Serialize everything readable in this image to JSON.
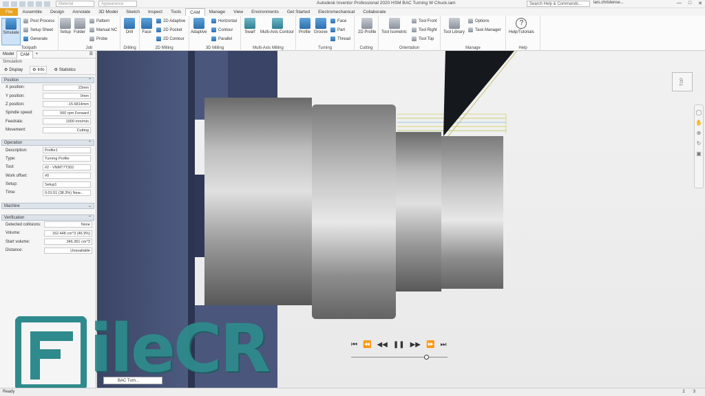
{
  "titlebar": {
    "material_placeholder": "Material",
    "appearance_placeholder": "Appearance",
    "doc_title": "Autodesk Inventor Professional 2020   HSM BAC Turning W Chuck.iam",
    "search_label": "Search Help & Commands...",
    "user": "lars.christense..."
  },
  "menu": {
    "tabs": [
      "File",
      "Assemble",
      "Design",
      "Annotate",
      "3D Model",
      "Sketch",
      "Inspect",
      "Tools",
      "CAM",
      "Manage",
      "View",
      "Environments",
      "Get Started",
      "Electromechanical",
      "Collaborate"
    ],
    "active": "CAM"
  },
  "ribbon": {
    "toolpath": {
      "label": "Toolpath",
      "simulate": "Simulate",
      "post_process": "Post Process",
      "setup_sheet": "Setup Sheet",
      "generate": "Generate"
    },
    "job": {
      "label": "Job",
      "setup": "Setup",
      "folder": "Folder",
      "pattern": "Pattern",
      "manual_nc": "Manual NC",
      "probe": "Probe"
    },
    "drilling": {
      "label": "Drilling",
      "drill": "Drill"
    },
    "milling2d": {
      "label": "2D Milling",
      "face": "Face",
      "adaptive": "2D Adaptive",
      "pocket": "2D Pocket",
      "contour": "2D Contour"
    },
    "milling3d": {
      "label": "3D Milling",
      "adaptive": "Adaptive",
      "horizontal": "Horizontal",
      "contour": "Contour",
      "parallel": "Parallel"
    },
    "multiaxis": {
      "label": "Multi-Axis Milling",
      "swarf": "Swarf",
      "multi_axis_contour": "Multi-Axis Contour"
    },
    "turning": {
      "label": "Turning",
      "profile": "Profile",
      "groove": "Groove",
      "face": "Face",
      "part": "Part",
      "thread": "Thread"
    },
    "cutting": {
      "label": "Cutting",
      "profile2d": "2D Profile"
    },
    "orientation": {
      "label": "Orientation",
      "tool_isometric": "Tool Isometric",
      "tool_front": "Tool Front",
      "tool_right": "Tool Right",
      "tool_top": "Tool Top"
    },
    "manage": {
      "label": "Manage",
      "tool_library": "Tool Library",
      "options": "Options",
      "task_manager": "Task Manager"
    },
    "help": {
      "label": "Help",
      "help_tutorials": "Help/Tutorials"
    }
  },
  "panel": {
    "tabs": [
      "Model",
      "CAM"
    ],
    "title": "Simulation",
    "subtabs": [
      "Display",
      "Info",
      "Statistics"
    ],
    "position": {
      "header": "Position",
      "rows": [
        {
          "label": "X position:",
          "value": "23mm"
        },
        {
          "label": "Y position:",
          "value": "0mm"
        },
        {
          "label": "Z position:",
          "value": "-15.6814mm"
        },
        {
          "label": "Spindle speed:",
          "value": "560 rpm Forward"
        },
        {
          "label": "Feedrate:",
          "value": "1000 mm/min"
        },
        {
          "label": "Movement:",
          "value": "Cutting"
        }
      ]
    },
    "operation": {
      "header": "Operation",
      "rows": [
        {
          "label": "Description:",
          "value": "Profile1"
        },
        {
          "label": "Type:",
          "value": "Turning Profile"
        },
        {
          "label": "Tool:",
          "value": "#2 - VNMT7T302"
        },
        {
          "label": "Work offset:",
          "value": "#0"
        },
        {
          "label": "Setup:",
          "value": "Setup1"
        },
        {
          "label": "Time:",
          "value": "0:01:51 (38.3%) New..."
        }
      ]
    },
    "machine": {
      "header": "Machine"
    },
    "verification": {
      "header": "Verification",
      "rows": [
        {
          "label": "Detected collisions:",
          "value": "None"
        },
        {
          "label": "Volume:",
          "value": "162.448 cm^3 (46.9%)"
        },
        {
          "label": "Start volume:",
          "value": "346.361 cm^3"
        },
        {
          "label": "Distance:",
          "value": "Unavailable"
        }
      ]
    }
  },
  "viewcube_label": "TOP",
  "doc_tab_label": "BAC Turn...",
  "status": {
    "left": "Ready",
    "num1": "2",
    "num2": "3"
  },
  "watermark": "FileCR"
}
